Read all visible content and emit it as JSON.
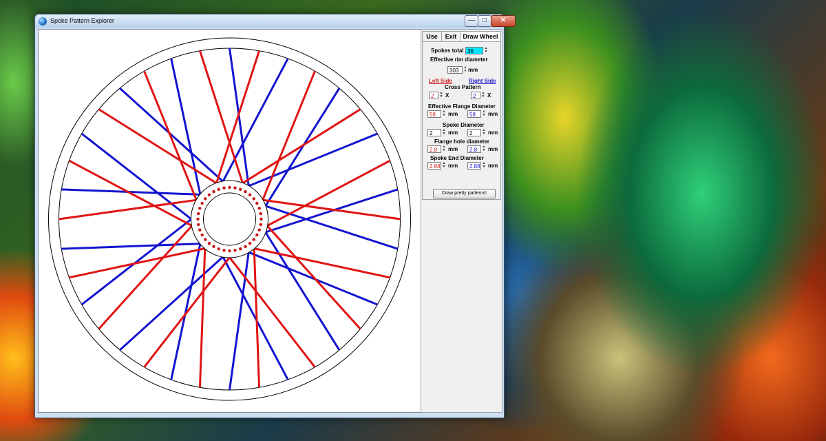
{
  "window": {
    "title": "Spoke Pattern Explorer",
    "min_glyph": "—",
    "max_glyph": "□",
    "close_glyph": "✕"
  },
  "tabs": [
    {
      "label": "Use"
    },
    {
      "label": "Exit"
    },
    {
      "label": "Draw Wheel"
    }
  ],
  "panel": {
    "spokes_total_label": "Spokes total",
    "spokes_total_value": "36",
    "rim_label": "Effective rim diameter",
    "rim_value": "303",
    "rim_unit": "mm",
    "left_side_label": "Left Side",
    "right_side_label": "Right Side",
    "cross_label": "Cross Pattern",
    "cross_left": "2",
    "cross_right": "2",
    "cross_suffix": "X",
    "flange_label": "Effective Flange Diameter",
    "flange_left": "58",
    "flange_right": "58",
    "spoke_dia_label": "Spoke Diameter",
    "spoke_dia_left": "2",
    "spoke_dia_right": "2",
    "hole_label": "Flange hole diameter",
    "hole_left": "2.8",
    "hole_right": "2.8",
    "end_label": "Spoke End Diameter",
    "end_left": "2.88",
    "end_right": "2.88",
    "unit_mm": "mm",
    "draw_button": "Draw pretty patterns!"
  },
  "colors": {
    "left_spokes": "#e01414",
    "right_spokes": "#1414d0",
    "input_highlight": "#00e5ff"
  }
}
